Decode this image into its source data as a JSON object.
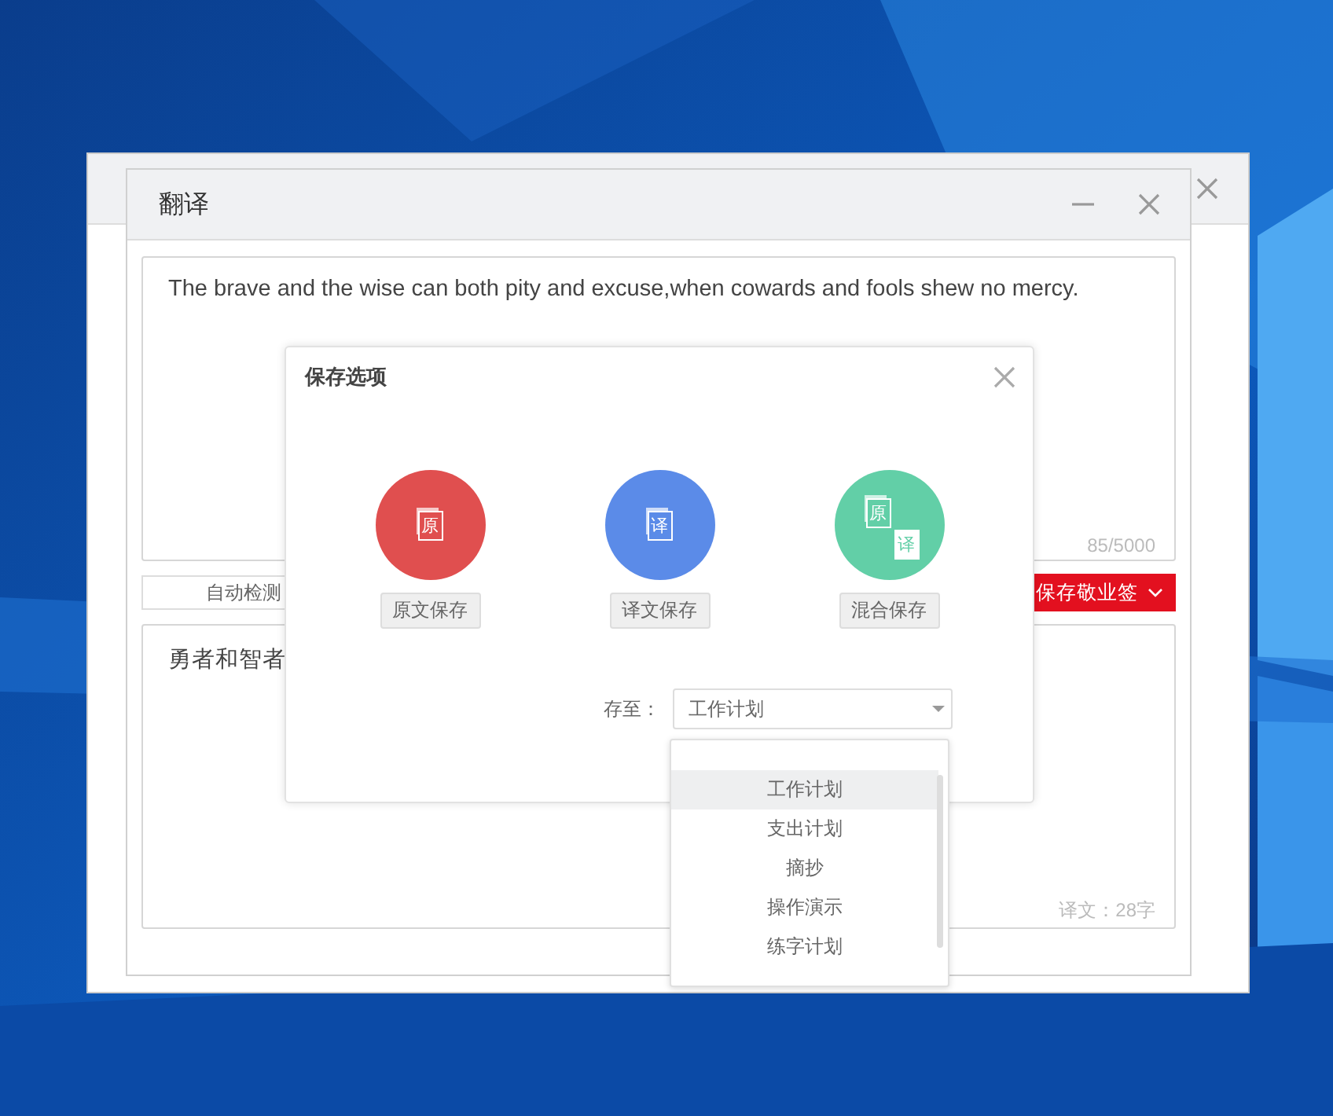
{
  "window": {
    "title": "翻译"
  },
  "source": {
    "text": "The brave and the wise can both pity and excuse,when cowards and fools shew no mercy.",
    "counter": "85/5000"
  },
  "language_select": {
    "value": "自动检测"
  },
  "save_button": {
    "label": "保存敬业签"
  },
  "target": {
    "text": "勇者和智者",
    "counter": "译文：28字"
  },
  "dialog": {
    "title": "保存选项",
    "options": [
      {
        "kind": "single",
        "glyphs": [
          "原"
        ],
        "label": "原文保存",
        "color": "#e04f4f"
      },
      {
        "kind": "single",
        "glyphs": [
          "译"
        ],
        "label": "译文保存",
        "color": "#5b8be8"
      },
      {
        "kind": "mixed",
        "glyphs": [
          "原",
          "译"
        ],
        "label": "混合保存",
        "color": "#62cfa7"
      }
    ],
    "save_to": {
      "label": "存至：",
      "value": "工作计划"
    },
    "dropdown": {
      "items": [
        {
          "label": "工作计划",
          "selected": true
        },
        {
          "label": "支出计划",
          "selected": false
        },
        {
          "label": "摘抄",
          "selected": false
        },
        {
          "label": "操作演示",
          "selected": false
        },
        {
          "label": "练字计划",
          "selected": false
        }
      ]
    }
  }
}
